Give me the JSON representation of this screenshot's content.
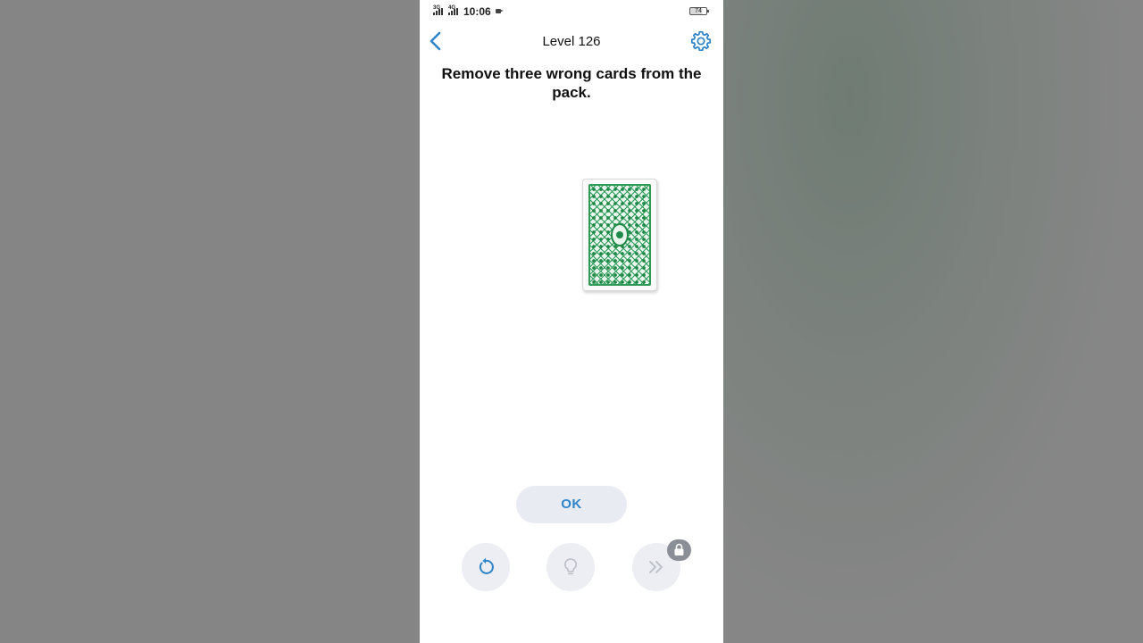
{
  "status_bar": {
    "network_1": "3G",
    "network_2": "4G",
    "time": "10:06",
    "battery": "74"
  },
  "header": {
    "title": "Level 126",
    "accent_color": "#2f84c8"
  },
  "puzzle": {
    "instruction": "Remove three wrong cards from the pack.",
    "card_back_color": "#2f9a55"
  },
  "actions": {
    "ok_label": "OK",
    "buttons": [
      "restart-icon",
      "hint-lightbulb-icon",
      "skip-icon"
    ],
    "skip_locked": true
  }
}
